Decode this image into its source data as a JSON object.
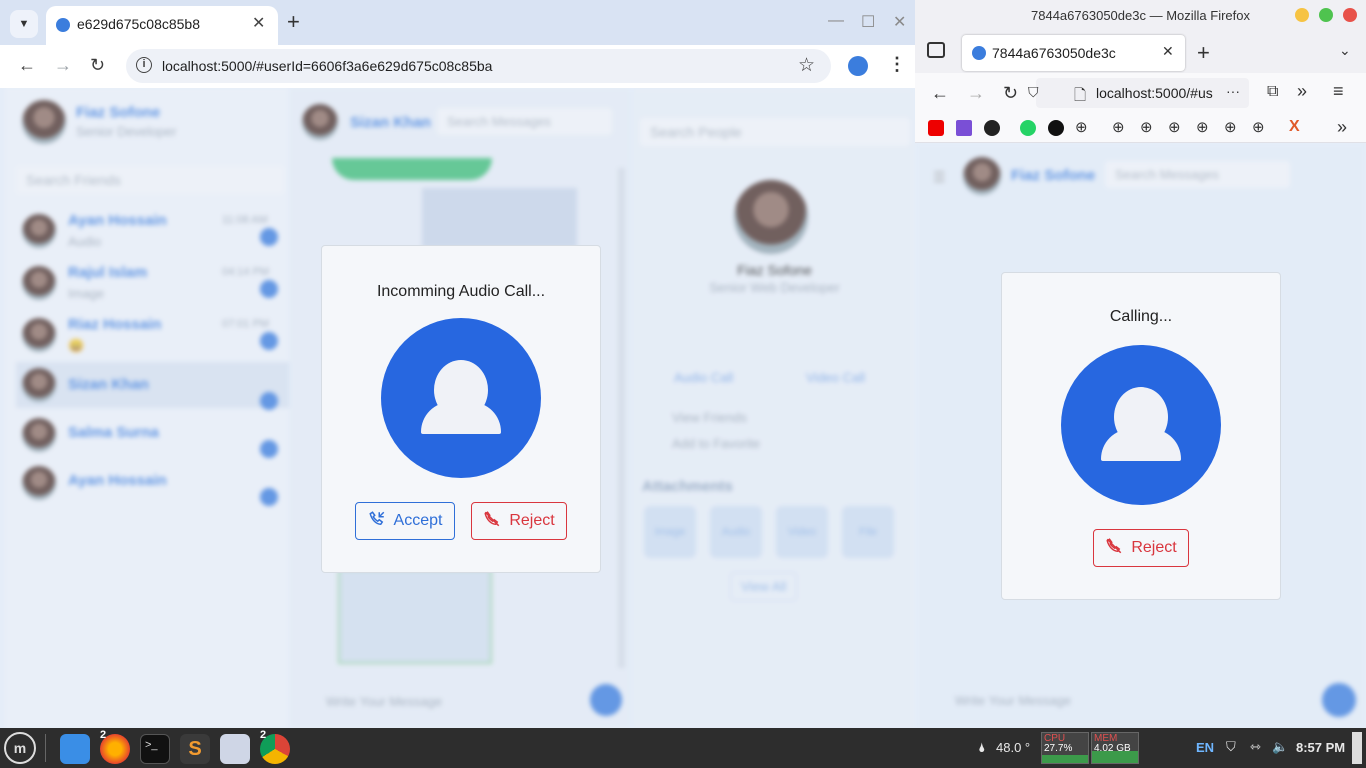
{
  "chrome": {
    "tab_title": "e629d675c08c85b8",
    "url": "localhost:5000/#userId=6606f3a6e629d675c08c85ba",
    "tab_menu_icon": "chevron-down-icon",
    "new_tab": "+",
    "window_controls": [
      "—",
      "☐",
      "✕"
    ]
  },
  "app": {
    "me": {
      "name": "Fiaz Sofone",
      "role": "Senior Developer"
    },
    "search_friends_placeholder": "Search Friends",
    "friends": [
      {
        "name": "Ayan Hossain",
        "preview": "Audio",
        "time": "11:08 AM"
      },
      {
        "name": "Rajul Islam",
        "preview": "Image",
        "time": "04:14 PM"
      },
      {
        "name": "Riaz Hossain",
        "preview": "😄",
        "time": "07:01 PM"
      },
      {
        "name": "Sizan Khan",
        "preview": "",
        "time": ""
      },
      {
        "name": "Salma Surna",
        "preview": "",
        "time": ""
      },
      {
        "name": "Ayan Hossain",
        "preview": "",
        "time": ""
      }
    ],
    "chat_header": {
      "name": "Sizan Khan",
      "search_placeholder": "Search Messages"
    },
    "message_placeholder": "Write Your Message",
    "profile": {
      "search_placeholder": "Search People",
      "name": "Fiaz Sofone",
      "role": "Senior Web Developer",
      "audio_call": "Audio Call",
      "video_call": "Video Call",
      "view_friends": "View Friends",
      "add_favorite": "Add to Favorite",
      "attachments_title": "Attachments",
      "attachments": [
        "Image",
        "Audio",
        "Video",
        "File"
      ],
      "view_all": "View All"
    }
  },
  "incoming_modal": {
    "title": "Incomming Audio Call...",
    "accept_label": "Accept",
    "reject_label": "Reject"
  },
  "firefox": {
    "window_title": "7844a6763050de3c — Mozilla Firefox",
    "tab_title": "7844a6763050de3c",
    "url": "localhost:5000/#us",
    "url_more": "···",
    "chat_name": "Fiaz Sofone",
    "search_placeholder": "Search Messages",
    "message_placeholder": "Write Your Message"
  },
  "calling_modal": {
    "title": "Calling...",
    "reject_label": "Reject"
  },
  "taskbar": {
    "firefox_badge": "2",
    "chrome_badge": "2",
    "temperature": "48.0 °",
    "cpu_label": "CPU",
    "cpu_value": "27.7%",
    "mem_label": "MEM",
    "mem_value": "4.02 GB",
    "lang": "EN",
    "clock": "8:57 PM"
  },
  "colors": {
    "accent_blue": "#2767e0",
    "reject_red": "#d9363e",
    "accept_blue": "#2f6fd8",
    "chrome_tabstrip": "#d9e3f3"
  }
}
